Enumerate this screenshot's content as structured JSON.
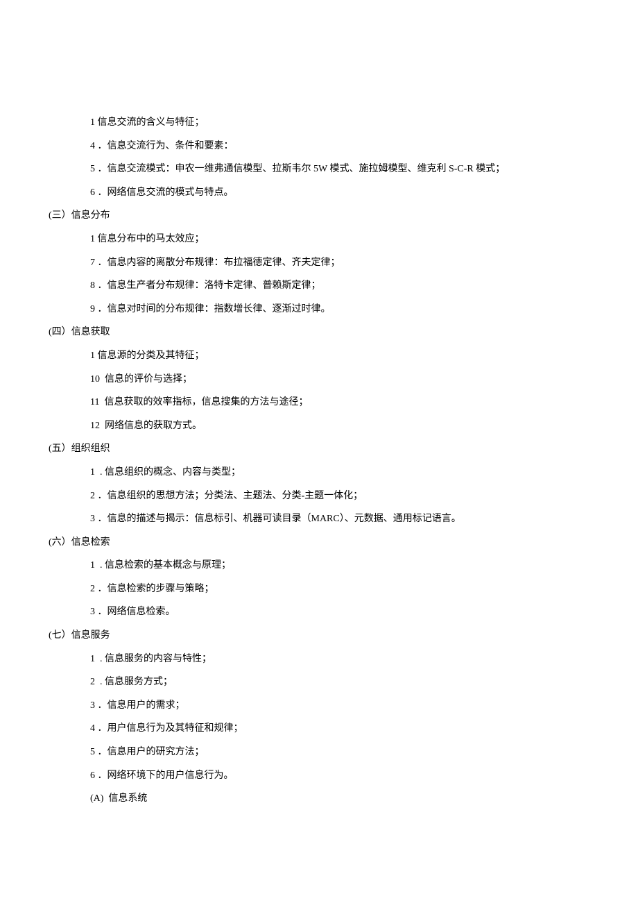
{
  "lines": [
    {
      "cls": "indent-2",
      "text": "1 信息交流的含义与特征；"
    },
    {
      "cls": "indent-2",
      "text": "4 ．信息交流行为、条件和要素："
    },
    {
      "cls": "indent-2",
      "text": "5 ．信息交流模式：申农一维弗通信模型、拉斯韦尔 5W 模式、施拉姆模型、维克利 S-C-R 模式；"
    },
    {
      "cls": "indent-2",
      "text": "6 ．网络信息交流的模式与特点。"
    },
    {
      "cls": "indent-1",
      "text": "(三）信息分布"
    },
    {
      "cls": "indent-2",
      "text": "1 信息分布中的马太效应；"
    },
    {
      "cls": "indent-2",
      "text": "7 ．信息内容的离散分布规律：布拉福德定律、齐夫定律；"
    },
    {
      "cls": "indent-2",
      "text": "8 ．信息生产者分布规律：洛特卡定律、普赖斯定律；"
    },
    {
      "cls": "indent-2",
      "text": "9 ．信息对时间的分布规律：指数增长律、逐渐过时律。"
    },
    {
      "cls": "indent-1",
      "text": "(四）信息获取"
    },
    {
      "cls": "indent-2",
      "text": "1 信息源的分类及其特征；"
    },
    {
      "cls": "indent-2",
      "text": "10  信息的评价与选择；"
    },
    {
      "cls": "indent-2",
      "text": "11  信息获取的效率指标，信息搜集的方法与途径；"
    },
    {
      "cls": "indent-2",
      "text": "12  网络信息的获取方式。"
    },
    {
      "cls": "indent-1",
      "text": "(五）组织组织"
    },
    {
      "cls": "indent-2",
      "text": "1  . 信息组织的概念、内容与类型；"
    },
    {
      "cls": "indent-2",
      "text": "2 ．信息组织的思想方法；分类法、主题法、分类-主题一体化；"
    },
    {
      "cls": "indent-2",
      "text": "3 ．信息的描述与揭示：信息标引、机器可读目录（MARC）、元数据、通用标记语言。"
    },
    {
      "cls": "indent-1",
      "text": "(六）信息检索"
    },
    {
      "cls": "indent-2",
      "text": "1  . 信息检索的基本概念与原理；"
    },
    {
      "cls": "indent-2",
      "text": "2 ．信息检索的步骤与策略；"
    },
    {
      "cls": "indent-2",
      "text": "3 ．网络信息检索。"
    },
    {
      "cls": "indent-1",
      "text": "(七）信息服务"
    },
    {
      "cls": "indent-2",
      "text": "1  . 信息服务的内容与特性；"
    },
    {
      "cls": "indent-2",
      "text": "2  . 信息服务方式；"
    },
    {
      "cls": "indent-2",
      "text": "3 ．信息用户的需求；"
    },
    {
      "cls": "indent-2",
      "text": "4 ．用户信息行为及其特征和规律；"
    },
    {
      "cls": "indent-2",
      "text": "5 ．信息用户的研究方法；"
    },
    {
      "cls": "indent-2",
      "text": "6 ．网络环境下的用户信息行为。"
    },
    {
      "cls": "indent-3",
      "text": "(A)  信息系统"
    }
  ]
}
